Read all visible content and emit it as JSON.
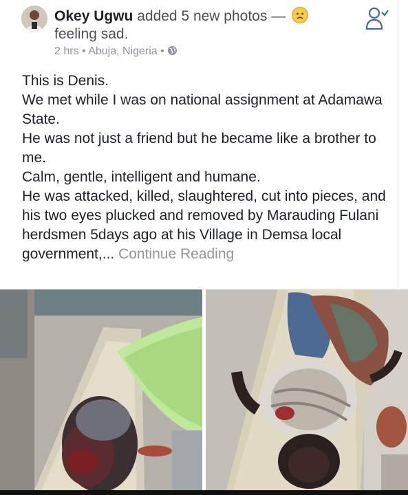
{
  "post": {
    "author": "Okey Ugwu",
    "action": " added 5 new photos — ",
    "feeling": "feeling sad.",
    "time": "2 hrs",
    "location": "Abuja, Nigeria",
    "sep": " • ",
    "privacy_icon": "globe-icon",
    "follow_icon": "add-friend-icon",
    "body": [
      "This is Denis.",
      "We met while I was on national assignment at Adamawa State.",
      "He was not just a friend but he became like a brother to me.",
      "Calm, gentle, intelligent and humane.",
      "He was attacked, killed, slaughtered, cut into pieces, and his two eyes plucked and removed by Marauding Fulani herdsmen 5days ago at his Village in Demsa local government,..."
    ],
    "continue_label": "Continue Reading"
  },
  "colors": {
    "author": "#1d2129",
    "meta": "#90949c",
    "accent": "#4267b2"
  }
}
